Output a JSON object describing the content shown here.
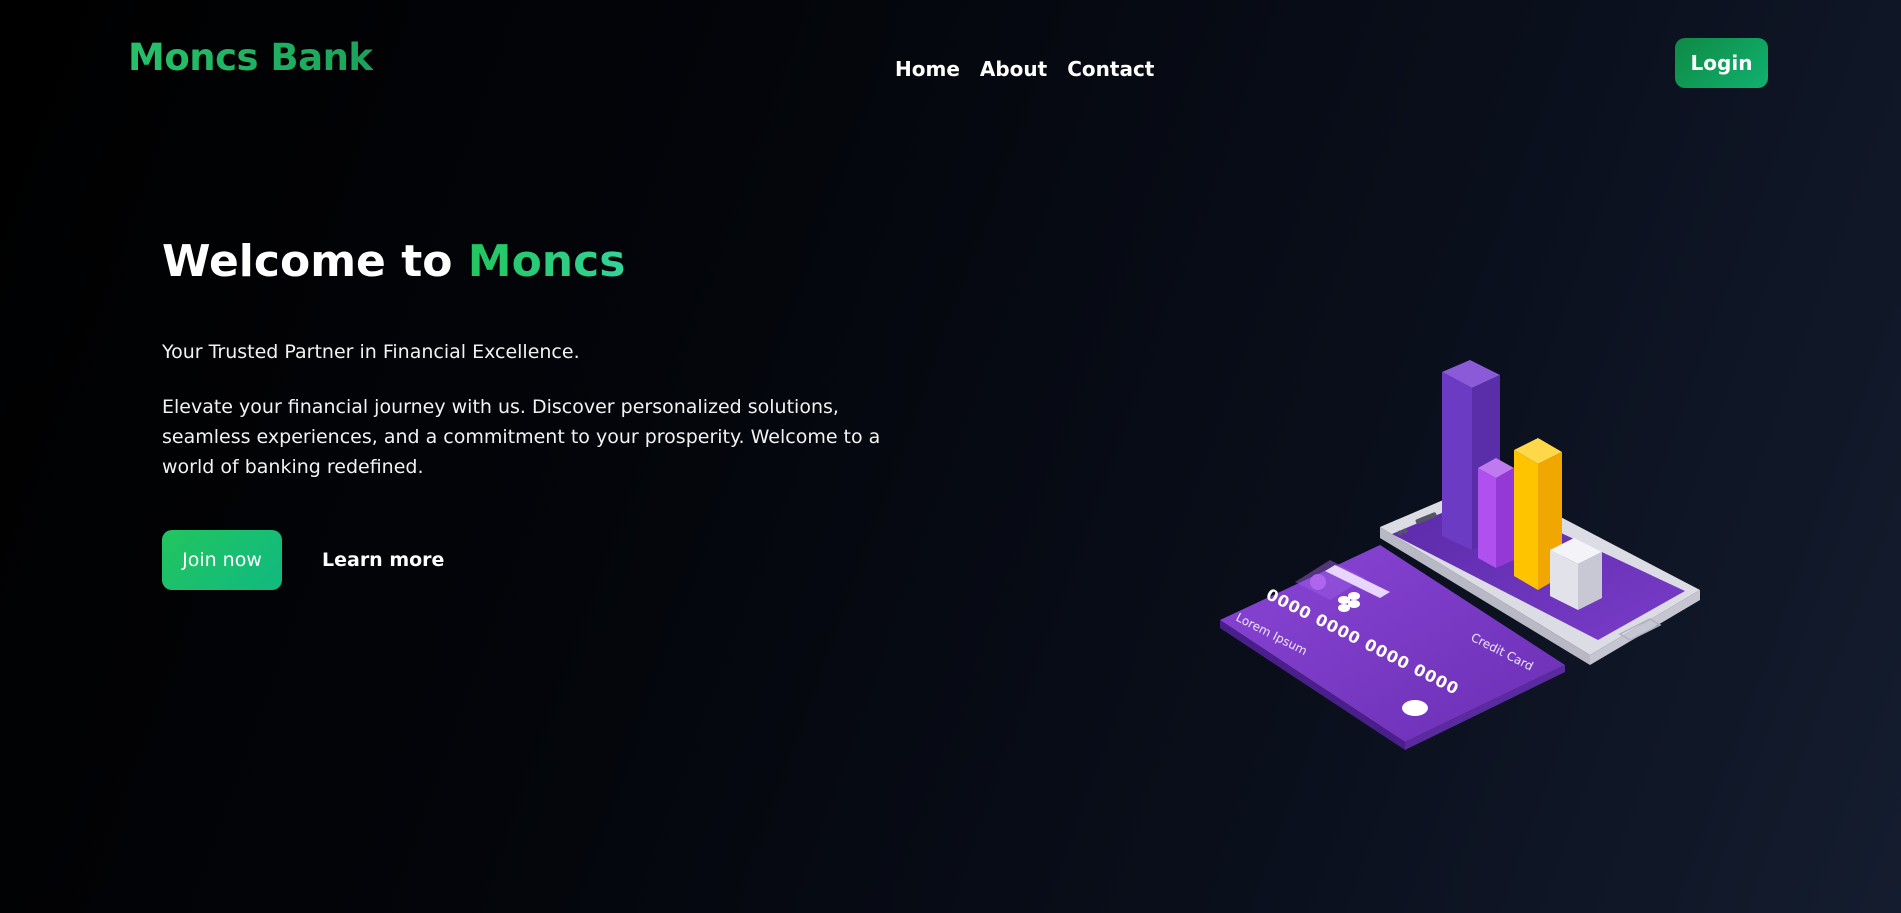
{
  "colors": {
    "brand_green": "#22c55e",
    "button_green": "#10b981",
    "background_dark": "#000000",
    "background_navy": "#141d2f",
    "illustration_purple": "#7b3fc4",
    "illustration_yellow": "#ffc400"
  },
  "navbar": {
    "brand": "Moncs Bank",
    "links": [
      "Home",
      "About",
      "Contact"
    ],
    "login_label": "Login"
  },
  "hero": {
    "title_prefix": "Welcome to",
    "title_accent": "Moncs",
    "tagline": "Your Trusted Partner in Financial Excellence.",
    "description": "Elevate your financial journey with us. Discover personalized solutions, seamless experiences, and a commitment to your prosperity. Welcome to a world of banking redefined.",
    "join_label": "Join now",
    "learn_label": "Learn more"
  },
  "illustration": {
    "card_number": "0000 0000 0000 0000",
    "card_holder": "Lorem Ipsum",
    "card_type": "Credit Card",
    "icons": [
      "phone-icon",
      "credit-card-icon",
      "bar-chart-icon"
    ]
  }
}
